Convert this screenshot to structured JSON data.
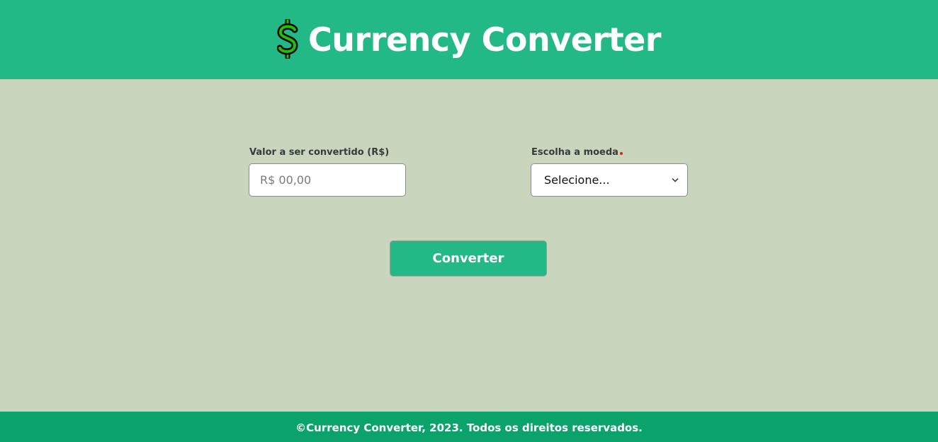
{
  "header": {
    "title": "Currency Converter",
    "logo_icon": "dollar-sign-icon"
  },
  "form": {
    "amount": {
      "label": "Valor a ser convertido (R$)",
      "placeholder": "R$ 00,00",
      "value": ""
    },
    "currency": {
      "label": "Escolha a moeda",
      "required": true,
      "selected": "Selecione..."
    },
    "convert_label": "Converter"
  },
  "footer": {
    "text": "©Currency Converter, 2023. Todos os direitos reservados."
  },
  "colors": {
    "header_bg": "#22b986",
    "page_bg": "#c9d5bc",
    "footer_bg": "#0ca26c",
    "button_bg": "#22b986",
    "required_dot": "#e01f1f",
    "logo_green": "#1fc200"
  }
}
